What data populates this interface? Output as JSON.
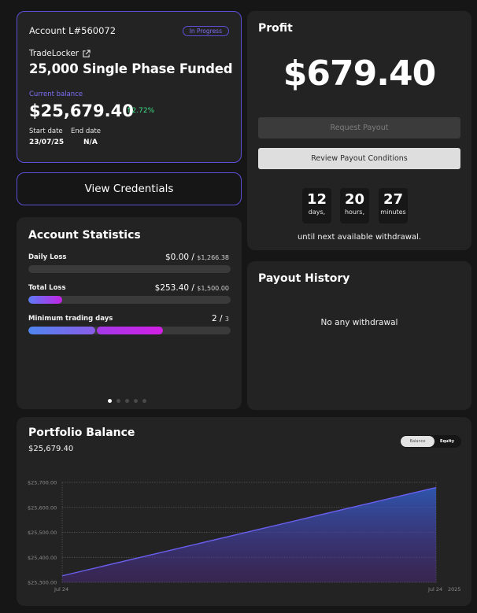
{
  "account": {
    "number": "Account L#560072",
    "status": "In Progress",
    "platform": "TradeLocker",
    "plan": "25,000 Single Phase Funded",
    "current_balance_label": "Current balance",
    "current_balance": "$25,679.40",
    "change": "↑2.72%",
    "start_label": "Start date",
    "start_value": "23/07/25",
    "end_label": "End date",
    "end_value": "N/A"
  },
  "view_credentials": "View Credentials",
  "statistics": {
    "title": "Account Statistics",
    "rows": [
      {
        "label": "Daily Loss",
        "value": "$0.00",
        "sep": " / ",
        "max": "$1,266.38",
        "fraction": 0
      },
      {
        "label": "Total Loss",
        "value": "$253.40",
        "sep": " / ",
        "max": "$1,500.00",
        "fraction": 0.169
      },
      {
        "label": "Minimum trading days",
        "value": "2",
        "sep": " / ",
        "max": "3",
        "fraction": 0.667
      }
    ],
    "pager": {
      "count": 5,
      "active": 0
    }
  },
  "profit": {
    "title": "Profit",
    "amount": "$679.40",
    "request_payout": "Request Payout",
    "review_conditions": "Review Payout Conditions",
    "countdown": [
      {
        "value": "12",
        "unit": "days,"
      },
      {
        "value": "20",
        "unit": "hours,"
      },
      {
        "value": "27",
        "unit": "minutes"
      }
    ],
    "until_text": "until next available withdrawal."
  },
  "payout_history": {
    "title": "Payout History",
    "empty_text": "No any withdrawal"
  },
  "portfolio": {
    "title": "Portfolio Balance",
    "value": "$25,679.40",
    "toggle_balance": "Balance",
    "toggle_equity": "Equity",
    "active_toggle": "Balance"
  },
  "colors": {
    "accent": "#5b4fd6",
    "positive": "#3ddc84",
    "line": "#6a5ff0"
  },
  "chart_data": {
    "type": "area",
    "title": "",
    "xlabel": "",
    "ylabel": "",
    "x_ticks": [
      "Jul 24",
      "Jul 24",
      "2025"
    ],
    "y_ticks": [
      "$25,700.00",
      "$25,600.00",
      "$25,500.00",
      "$25,400.00",
      "$25,300.00"
    ],
    "y_tick_values": [
      25700,
      25600,
      25500,
      25400,
      25300
    ],
    "ylim": [
      25300,
      25700
    ],
    "series": [
      {
        "values": [
          25326,
          25679.4
        ]
      }
    ],
    "grid": true,
    "legend": "none"
  }
}
